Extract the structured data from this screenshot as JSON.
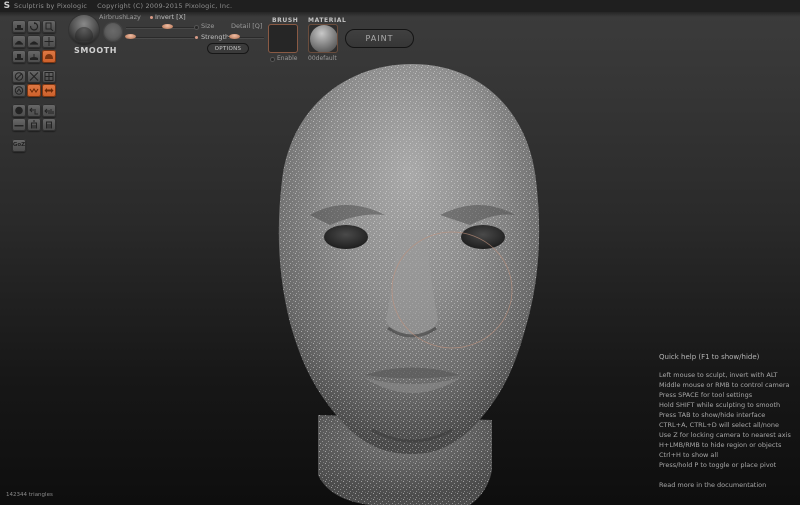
{
  "window": {
    "app_name": "Sculptris by Pixologic",
    "copyright": "Copyright (C) 2009-2015 Pixologic, Inc."
  },
  "toolbar": {
    "brush_name": "SMOOTH",
    "airbrush_label": "Airbrush",
    "lazy_label": "Lazy",
    "invert_label": "Invert [X]",
    "size_label": "Size",
    "detail_label": "Detail [Q]",
    "strength_label": "Strength",
    "options_label": "OPTIONS",
    "brush_section_label": "BRUSH",
    "brush_enable_label": "Enable",
    "material_section_label": "MATERIAL",
    "material_name": "00default",
    "paint_label": "PAINT",
    "sliders": {
      "lazy_value": 0.75,
      "strength_value": 0.05,
      "detail_value": 0.35
    }
  },
  "tools": [
    {
      "id": "draw",
      "icon": "draw-icon",
      "active": false
    },
    {
      "id": "rotate",
      "icon": "rotate-icon",
      "active": false
    },
    {
      "id": "scale",
      "icon": "scale-icon",
      "active": false
    },
    {
      "id": "inflate",
      "icon": "inflate-icon",
      "active": false
    },
    {
      "id": "pinch",
      "icon": "pinch-icon",
      "active": false
    },
    {
      "id": "grab",
      "icon": "move-icon",
      "active": false
    },
    {
      "id": "flatten",
      "icon": "flatten-icon",
      "active": false
    },
    {
      "id": "crease",
      "icon": "crease-icon",
      "active": false
    },
    {
      "id": "smooth",
      "icon": "smooth-icon",
      "active": true
    },
    {
      "id": "symmetry",
      "icon": "symmetry-icon",
      "active": false
    },
    {
      "id": "hide",
      "icon": "hide-icon",
      "active": false
    },
    {
      "id": "grid",
      "icon": "grid-icon",
      "active": false
    },
    {
      "id": "wireframe",
      "icon": "wireframe-icon",
      "active": false
    },
    {
      "id": "mask",
      "icon": "mask-icon",
      "active": true
    },
    {
      "id": "mirror",
      "icon": "mirror-icon",
      "active": true
    },
    {
      "id": "new-sphere",
      "icon": "sphere-icon",
      "active": false
    },
    {
      "id": "reduce-brush",
      "icon": "reduce-brush-icon",
      "active": false
    },
    {
      "id": "reduce-selected",
      "icon": "reduce-selected-icon",
      "active": false
    },
    {
      "id": "new-plane",
      "icon": "plane-icon",
      "active": false
    },
    {
      "id": "subdivide-all",
      "icon": "subdivide-all-icon",
      "active": false
    },
    {
      "id": "subdivide-selected",
      "icon": "subdivide-selected-icon",
      "active": false
    },
    {
      "id": "goz",
      "icon": "goz-icon",
      "label": "GoZ",
      "active": false
    }
  ],
  "quick_help": {
    "title": "Quick help (F1 to show/hide)",
    "lines": [
      "Left mouse to sculpt, invert with ALT",
      "Middle mouse or RMB to control camera",
      "Press SPACE for tool settings",
      "Hold SHIFT while sculpting to smooth",
      "Press TAB to show/hide interface",
      "CTRL+A, CTRL+D will select all/none",
      "Use Z for locking camera to nearest axis",
      "H+LMB/RMB to hide region or objects",
      "Ctrl+H to show all",
      "Press/hold P to toggle or place pivot"
    ],
    "link": "Read more in the documentation"
  },
  "status": {
    "triangles": "142344 triangles"
  },
  "colors": {
    "accent": "#d9693a",
    "knob": "#d79a86"
  }
}
